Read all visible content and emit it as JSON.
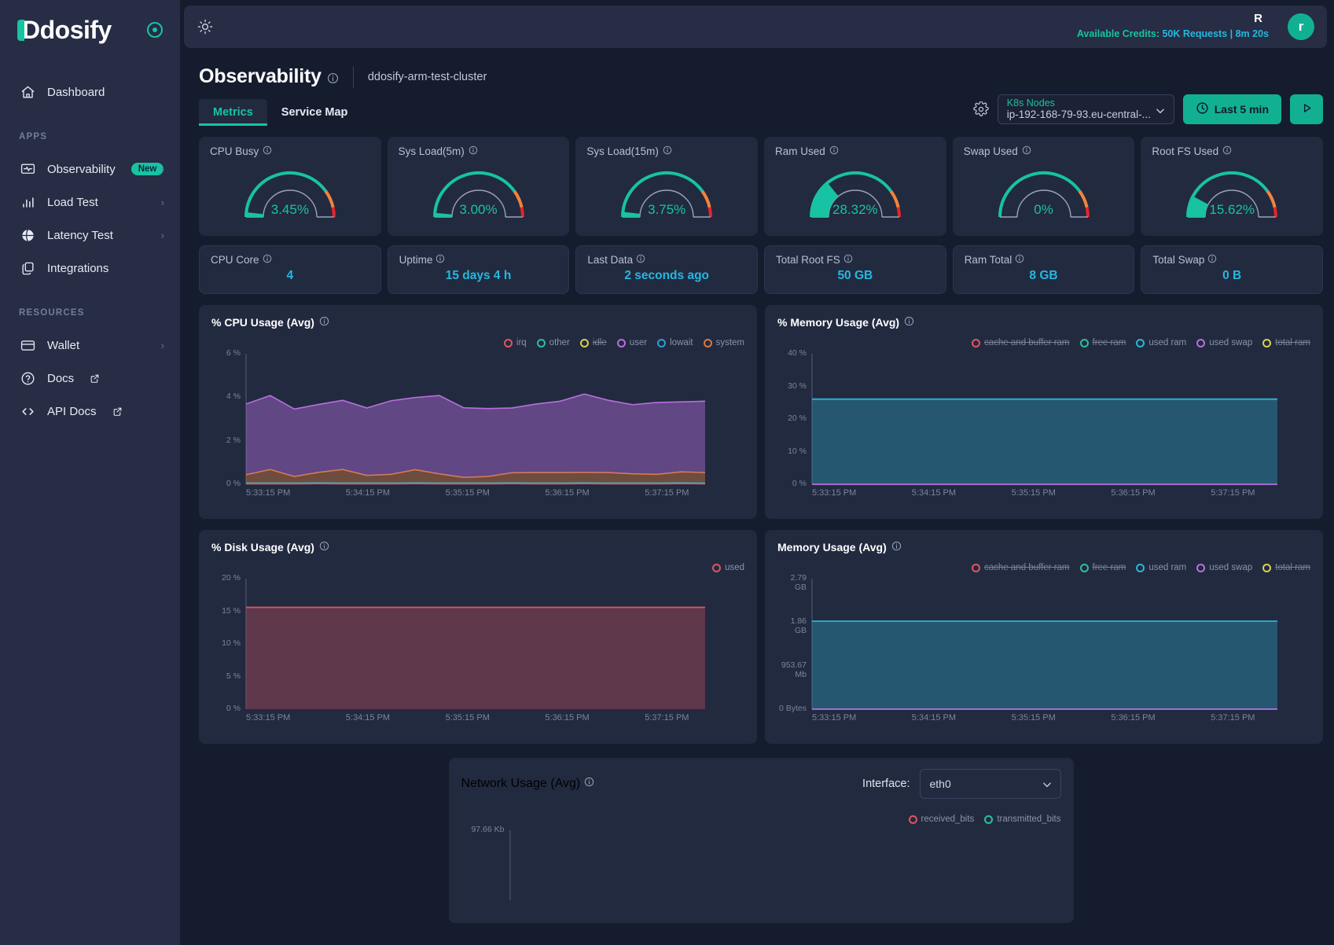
{
  "sidebar": {
    "logo_text": "Ddosify",
    "collapse_icon": "circle-dot-icon",
    "dashboard": {
      "label": "Dashboard",
      "icon": "home-icon"
    },
    "apps_section": "APPS",
    "resources_section": "RESOURCES",
    "apps": [
      {
        "label": "Observability",
        "icon": "monitor-pulse-icon",
        "badge": "New",
        "chevron": "›"
      },
      {
        "label": "Load Test",
        "icon": "bar-chart-icon",
        "chevron": "›"
      },
      {
        "label": "Latency Test",
        "icon": "globe-icon",
        "chevron": "›"
      },
      {
        "label": "Integrations",
        "icon": "layers-icon",
        "chevron": ""
      }
    ],
    "resources": [
      {
        "label": "Wallet",
        "icon": "credit-card-icon",
        "chevron": "›",
        "external": false
      },
      {
        "label": "Docs",
        "icon": "question-circle-icon",
        "chevron": "",
        "external": true
      },
      {
        "label": "API Docs",
        "icon": "code-brackets-icon",
        "chevron": "",
        "external": true
      }
    ]
  },
  "topbar": {
    "theme_toggle_icon": "sun-icon",
    "credits_label": "Available Credits:",
    "credits_value": "50K Requests | 8m 20s",
    "user_initial_small": "R",
    "avatar_initial": "r"
  },
  "header": {
    "title": "Observability",
    "title_info_icon": "info-icon",
    "cluster": "ddosify-arm-test-cluster",
    "tabs": [
      {
        "label": "Metrics",
        "active": true
      },
      {
        "label": "Service Map",
        "active": false
      }
    ]
  },
  "toolbar": {
    "settings_icon": "gear-icon",
    "node_select": {
      "label": "K8s Nodes",
      "value": "ip-192-168-79-93.eu-central-...",
      "chevron_icon": "chevron-down-icon"
    },
    "time_range": {
      "label": "Last 5 min",
      "icon": "clock-icon"
    },
    "run_button": {
      "icon": "play-icon"
    }
  },
  "gauges": [
    {
      "title": "CPU Busy",
      "value": "3.45%",
      "pct": 3.45
    },
    {
      "title": "Sys Load(5m)",
      "value": "3.00%",
      "pct": 3.0
    },
    {
      "title": "Sys Load(15m)",
      "value": "3.75%",
      "pct": 3.75
    },
    {
      "title": "Ram Used",
      "value": "28.32%",
      "pct": 28.32
    },
    {
      "title": "Swap Used",
      "value": "0%",
      "pct": 0
    },
    {
      "title": "Root FS Used",
      "value": "15.62%",
      "pct": 15.62
    }
  ],
  "stats": [
    {
      "title": "CPU Core",
      "value": "4"
    },
    {
      "title": "Uptime",
      "value": "15 days 4 h"
    },
    {
      "title": "Last Data",
      "value": "2 seconds ago"
    },
    {
      "title": "Total Root FS",
      "value": "50 GB"
    },
    {
      "title": "Ram Total",
      "value": "8 GB"
    },
    {
      "title": "Total Swap",
      "value": "0 B"
    }
  ],
  "colors": {
    "accent": "#17c3a2",
    "info": "#24b8e0",
    "panel": "#222a40",
    "sidebar": "#262d44",
    "background": "#151c2e",
    "gauge_warn": "#f2833c",
    "gauge_crit": "#e8242a"
  },
  "chart_data": [
    {
      "id": "cpu-usage",
      "type": "area",
      "title": "% CPU Usage (Avg)",
      "ylabel": "",
      "xlabel": "",
      "ylim": [
        0,
        6
      ],
      "yticks": [
        "0 %",
        "2 %",
        "4 %",
        "6 %"
      ],
      "x": [
        "5:33:15 PM",
        "5:34:15 PM",
        "5:35:15 PM",
        "5:36:15 PM",
        "5:37:15 PM"
      ],
      "grid": false,
      "legend_position": "top-right",
      "series": [
        {
          "name": "irq",
          "color": "#e0555f",
          "disabled": false,
          "values": [
            0.02,
            0.02,
            0.02,
            0.03,
            0.02,
            0.02,
            0.02,
            0.03,
            0.02,
            0.02,
            0.02,
            0.03,
            0.02,
            0.02,
            0.03,
            0.02,
            0.02,
            0.02,
            0.03,
            0.02
          ]
        },
        {
          "name": "other",
          "color": "#2bbfa0",
          "disabled": false,
          "values": [
            0.03,
            0.03,
            0.03,
            0.03,
            0.03,
            0.03,
            0.03,
            0.03,
            0.03,
            0.03,
            0.03,
            0.03,
            0.03,
            0.03,
            0.03,
            0.03,
            0.03,
            0.03,
            0.03,
            0.03
          ]
        },
        {
          "name": "idle",
          "color": "#d8d04b",
          "disabled": true,
          "values": []
        },
        {
          "name": "user",
          "color": "#b96fe0",
          "disabled": false,
          "values": [
            3.25,
            3.4,
            3.1,
            3.12,
            3.18,
            3.1,
            3.38,
            3.32,
            3.6,
            3.2,
            3.12,
            2.98,
            3.15,
            3.28,
            3.6,
            3.32,
            3.18,
            3.3,
            3.22,
            3.28
          ]
        },
        {
          "name": "lowait",
          "color": "#2e9fd0",
          "disabled": false,
          "values": [
            0.01,
            0.01,
            0.01,
            0.01,
            0.01,
            0.01,
            0.01,
            0.01,
            0.01,
            0.01,
            0.01,
            0.01,
            0.01,
            0.01,
            0.01,
            0.01,
            0.01,
            0.01,
            0.01,
            0.01
          ]
        },
        {
          "name": "system",
          "color": "#d97b3c",
          "disabled": false,
          "values": [
            0.38,
            0.62,
            0.3,
            0.48,
            0.62,
            0.35,
            0.4,
            0.6,
            0.42,
            0.26,
            0.3,
            0.46,
            0.48,
            0.48,
            0.48,
            0.48,
            0.42,
            0.4,
            0.5,
            0.48
          ]
        }
      ]
    },
    {
      "id": "memory-usage-pct",
      "type": "area",
      "title": "% Memory Usage (Avg)",
      "ylim": [
        0,
        40
      ],
      "yticks": [
        "0 %",
        "10 %",
        "20 %",
        "30 %",
        "40 %"
      ],
      "x": [
        "5:33:15 PM",
        "5:34:15 PM",
        "5:35:15 PM",
        "5:36:15 PM",
        "5:37:15 PM"
      ],
      "grid": false,
      "legend_position": "top-right",
      "series": [
        {
          "name": "cache and buffer ram",
          "color": "#e0555f",
          "disabled": true,
          "values": []
        },
        {
          "name": "free ram",
          "color": "#2bbfa0",
          "disabled": true,
          "values": []
        },
        {
          "name": "used ram",
          "color": "#2ab6d6",
          "disabled": false,
          "values": [
            26.1,
            26.1,
            26.1,
            26.1,
            26.1,
            26.1,
            26.1,
            26.1,
            26.1,
            26.1,
            26.1,
            26.1,
            26.1,
            26.1,
            26.1,
            26.1,
            26.1,
            26.1,
            26.1,
            26.1
          ]
        },
        {
          "name": "used swap",
          "color": "#b96fe0",
          "disabled": false,
          "values": [
            0,
            0,
            0,
            0,
            0,
            0,
            0,
            0,
            0,
            0,
            0,
            0,
            0,
            0,
            0,
            0,
            0,
            0,
            0,
            0
          ]
        },
        {
          "name": "total ram",
          "color": "#d8d04b",
          "disabled": true,
          "values": []
        }
      ]
    },
    {
      "id": "disk-usage",
      "type": "area",
      "title": "% Disk Usage (Avg)",
      "ylim": [
        0,
        20
      ],
      "yticks": [
        "0 %",
        "5 %",
        "10 %",
        "15 %",
        "20 %"
      ],
      "x": [
        "5:33:15 PM",
        "5:34:15 PM",
        "5:35:15 PM",
        "5:36:15 PM",
        "5:37:15 PM"
      ],
      "grid": false,
      "legend_position": "top-right",
      "series": [
        {
          "name": "used",
          "color": "#e0555f",
          "disabled": false,
          "values": [
            15.6,
            15.6,
            15.6,
            15.6,
            15.6,
            15.6,
            15.6,
            15.6,
            15.6,
            15.6,
            15.6,
            15.6,
            15.6,
            15.6,
            15.6,
            15.6,
            15.6,
            15.6,
            15.6,
            15.6
          ]
        }
      ]
    },
    {
      "id": "memory-usage-bytes",
      "type": "area",
      "title": "Memory Usage (Avg)",
      "ylim": [
        0,
        2.79
      ],
      "yticks": [
        "0 Bytes",
        "953.67 Mb",
        "1.86 GB",
        "2.79 GB"
      ],
      "x": [
        "5:33:15 PM",
        "5:34:15 PM",
        "5:35:15 PM",
        "5:36:15 PM",
        "5:37:15 PM"
      ],
      "grid": false,
      "legend_position": "top-right",
      "series": [
        {
          "name": "cache and buffer ram",
          "color": "#e0555f",
          "disabled": true,
          "values": []
        },
        {
          "name": "free ram",
          "color": "#2bbfa0",
          "disabled": true,
          "values": []
        },
        {
          "name": "used ram",
          "color": "#2ab6d6",
          "disabled": false,
          "values": [
            1.88,
            1.88,
            1.88,
            1.88,
            1.88,
            1.88,
            1.88,
            1.88,
            1.88,
            1.88,
            1.88,
            1.88,
            1.88,
            1.88,
            1.88,
            1.88,
            1.88,
            1.88,
            1.88,
            1.88
          ]
        },
        {
          "name": "used swap",
          "color": "#b96fe0",
          "disabled": false,
          "values": [
            0,
            0,
            0,
            0,
            0,
            0,
            0,
            0,
            0,
            0,
            0,
            0,
            0,
            0,
            0,
            0,
            0,
            0,
            0,
            0
          ]
        },
        {
          "name": "total ram",
          "color": "#d8d04b",
          "disabled": true,
          "values": []
        }
      ]
    },
    {
      "id": "network-usage",
      "type": "area",
      "title": "Network Usage (Avg)",
      "interface_label": "Interface:",
      "interface_value": "eth0",
      "yticks": [
        "97.66 Kb"
      ],
      "x": [],
      "grid": false,
      "legend_position": "top-right",
      "series": [
        {
          "name": "received_bits",
          "color": "#e0555f",
          "disabled": false,
          "values": []
        },
        {
          "name": "transmitted_bits",
          "color": "#2bbfa0",
          "disabled": false,
          "values": []
        }
      ]
    }
  ]
}
